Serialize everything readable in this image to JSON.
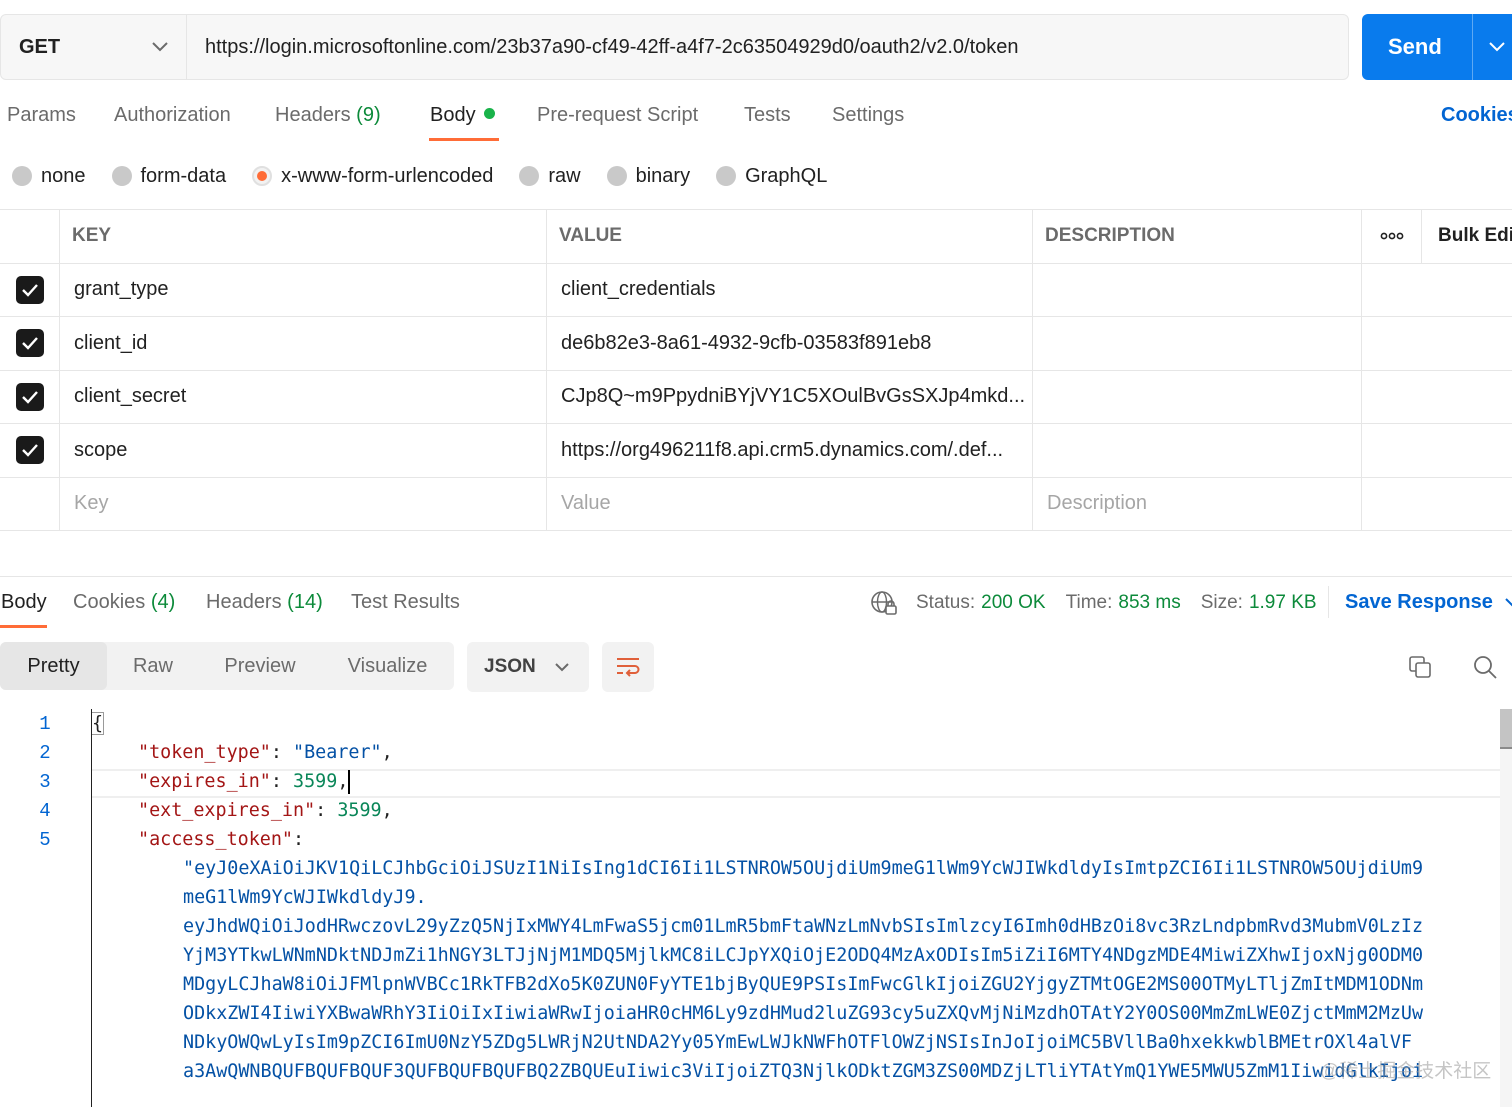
{
  "request": {
    "method": "GET",
    "url": "https://login.microsoftonline.com/23b37a90-cf49-42ff-a4f7-2c63504929d0/oauth2/v2.0/token",
    "send_label": "Send"
  },
  "request_tabs": [
    {
      "label": "Params"
    },
    {
      "label": "Authorization"
    },
    {
      "label": "Headers",
      "count": "(9)"
    },
    {
      "label": "Body"
    },
    {
      "label": "Pre-request Script"
    },
    {
      "label": "Tests"
    },
    {
      "label": "Settings"
    }
  ],
  "cookies_link": "Cookies",
  "body_types": [
    "none",
    "form-data",
    "x-www-form-urlencoded",
    "raw",
    "binary",
    "GraphQL"
  ],
  "selected_body_type": "x-www-form-urlencoded",
  "table": {
    "headers": {
      "key": "KEY",
      "value": "VALUE",
      "description": "DESCRIPTION",
      "bulk_edit": "Bulk Edi"
    },
    "rows": [
      {
        "key": "grant_type",
        "value": "client_credentials",
        "description": "",
        "checked": true
      },
      {
        "key": "client_id",
        "value": "de6b82e3-8a61-4932-9cfb-03583f891eb8",
        "description": "",
        "checked": true
      },
      {
        "key": "client_secret",
        "value": "CJp8Q~m9PpydniBYjVY1C5XOulBvGsSXJp4mkd...",
        "description": "",
        "checked": true
      },
      {
        "key": "scope",
        "value": "https://org496211f8.api.crm5.dynamics.com/.def...",
        "description": "",
        "checked": true
      }
    ],
    "placeholders": {
      "key": "Key",
      "value": "Value",
      "description": "Description"
    }
  },
  "response": {
    "tabs": [
      {
        "label": "Body"
      },
      {
        "label": "Cookies",
        "count": "(4)"
      },
      {
        "label": "Headers",
        "count": "(14)"
      },
      {
        "label": "Test Results"
      }
    ],
    "status_label": "Status:",
    "status_value": "200 OK",
    "time_label": "Time:",
    "time_value": "853 ms",
    "size_label": "Size:",
    "size_value": "1.97 KB",
    "save_label": "Save Response",
    "views": [
      "Pretty",
      "Raw",
      "Preview",
      "Visualize"
    ],
    "format": "JSON"
  },
  "code": {
    "line_numbers": [
      "1",
      "2",
      "3",
      "4",
      "5"
    ],
    "open_brace": "{",
    "token_type_key": "\"token_type\"",
    "token_type_value": "\"Bearer\"",
    "expires_in_key": "\"expires_in\"",
    "expires_in_value": "3599",
    "ext_expires_in_key": "\"ext_expires_in\"",
    "ext_expires_in_value": "3599",
    "access_token_key": "\"access_token\"",
    "access_token_lines": [
      "\"eyJ0eXAiOiJKV1QiLCJhbGciOiJSUzI1NiIsIng1dCI6Ii1LSTNROW5OUjdiUm9meG1lWm9YcWJIWkdldyIsImtpZCI6Ii1LSTNROW5OUjdiUm9",
      "meG1lWm9YcWJIWkdldyJ9.",
      "eyJhdWQiOiJodHRwczovL29yZzQ5NjIxMWY4LmFwaS5jcm01LmR5bmFtaWNzLmNvbSIsImlzcyI6Imh0dHBzOi8vc3RzLndpbmRvd3MubmV0LzIz",
      "YjM3YTkwLWNmNDktNDJmZi1hNGY3LTJjNjM1MDQ5MjlkMC8iLCJpYXQiOjE2ODQ4MzAxODIsIm5iZiI6MTY4NDgzMDE4MiwiZXhwIjoxNjg0ODM0",
      "MDgyLCJhaW8iOiJFMlpnWVBCc1RkTFB2dXo5K0ZUN0FyYTE1bjByQUE9PSIsImFwcGlkIjoiZGU2YjgyZTMtOGE2MS00OTMyLTljZmItMDM1ODNm",
      "ODkxZWI4IiwiYXBwaWRhY3IiOiIxIiwiaWRwIjoiaHR0cHM6Ly9zdHMud2luZG93cy5uZXQvMjNiMzdhOTAtY2Y0OS00MmZmLWE0ZjctMmM2MzUw",
      "NDkyOWQwLyIsIm9pZCI6ImU0NzY5ZDg5LWRjN2UtNDA2Yy05YmEwLWJkNWFhOTFlOWZjNSIsInJoIjoiMC5BVllBa0hxekkwblBMEtrOXl4alVF",
      "a3AwQWNBQUFBQUFBQUF3QUFBQUFBQUFBQ2ZBQUEuIiwic3ViIjoiZTQ3NjlkODktZGM3ZS00MDZjLTliYTAtYmQ1YWE5MWU5ZmM1IiwidGlkIjoi"
    ]
  },
  "watermark": "@稀土掘金技术社区"
}
